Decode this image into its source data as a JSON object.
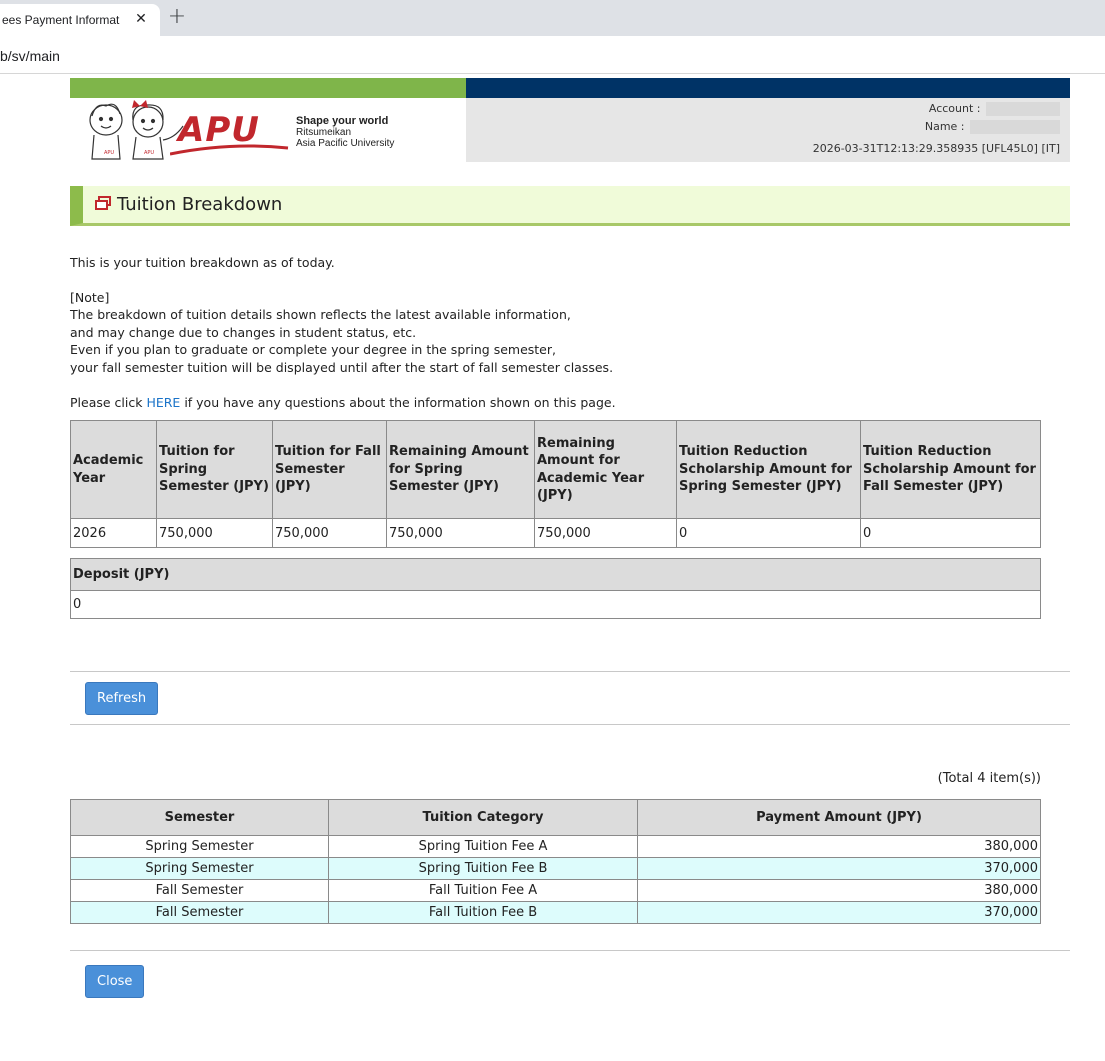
{
  "browser": {
    "tab_title": "ees Payment Informat",
    "tab_close": "✕",
    "new_tab": "+",
    "url": "b/sv/main"
  },
  "header": {
    "logo_text": "APU",
    "logo_tagline": "Shape your world",
    "logo_university_1": "Ritsumeikan",
    "logo_university_2": "Asia Pacific University",
    "account_label": "Account :",
    "name_label": "Name :",
    "session_info": "2026-03-31T12:13:29.358935 [UFL45L0] [IT]"
  },
  "page": {
    "title": "Tuition Breakdown",
    "intro": "This is your tuition breakdown as of today.",
    "note_heading": "[Note]",
    "note_lines": [
      "The breakdown of tuition details shown reflects the latest available information,",
      "and may change due to changes in student status, etc.",
      "Even if you plan to graduate or complete your degree in the spring semester,",
      "your fall semester tuition will be displayed until after the start of fall semester classes."
    ],
    "contact_prefix": "Please click ",
    "contact_link": "HERE",
    "contact_suffix": " if you have any questions about the information shown on this page."
  },
  "summary_table": {
    "headers": [
      "Academic Year",
      "Tuition for Spring Semester (JPY)",
      "Tuition for Fall Semester (JPY)",
      "Remaining Amount for Spring Semester (JPY)",
      "Remaining Amount for Academic Year (JPY)",
      "Tuition Reduction Scholarship Amount for Spring Semester (JPY)",
      "Tuition Reduction Scholarship Amount for Fall Semester (JPY)"
    ],
    "row": [
      "2026",
      "750,000",
      "750,000",
      "750,000",
      "750,000",
      "0",
      "0"
    ]
  },
  "deposit_table": {
    "header": "Deposit (JPY)",
    "value": "0"
  },
  "actions": {
    "refresh_label": "Refresh",
    "close_label": "Close"
  },
  "detail_table": {
    "total_text": "(Total 4 item(s))",
    "headers": [
      "Semester",
      "Tuition Category",
      "Payment Amount (JPY)"
    ],
    "rows": [
      [
        "Spring Semester",
        "Spring Tuition Fee A",
        "380,000"
      ],
      [
        "Spring Semester",
        "Spring Tuition Fee B",
        "370,000"
      ],
      [
        "Fall Semester",
        "Fall Tuition Fee A",
        "380,000"
      ],
      [
        "Fall Semester",
        "Fall Tuition Fee B",
        "370,000"
      ]
    ]
  },
  "colors": {
    "brand_red": "#c1272d",
    "bar_green": "#7fb54a",
    "bar_navy": "#003366",
    "button_blue": "#4a90d9",
    "row_alt": "#ddfcfc"
  }
}
